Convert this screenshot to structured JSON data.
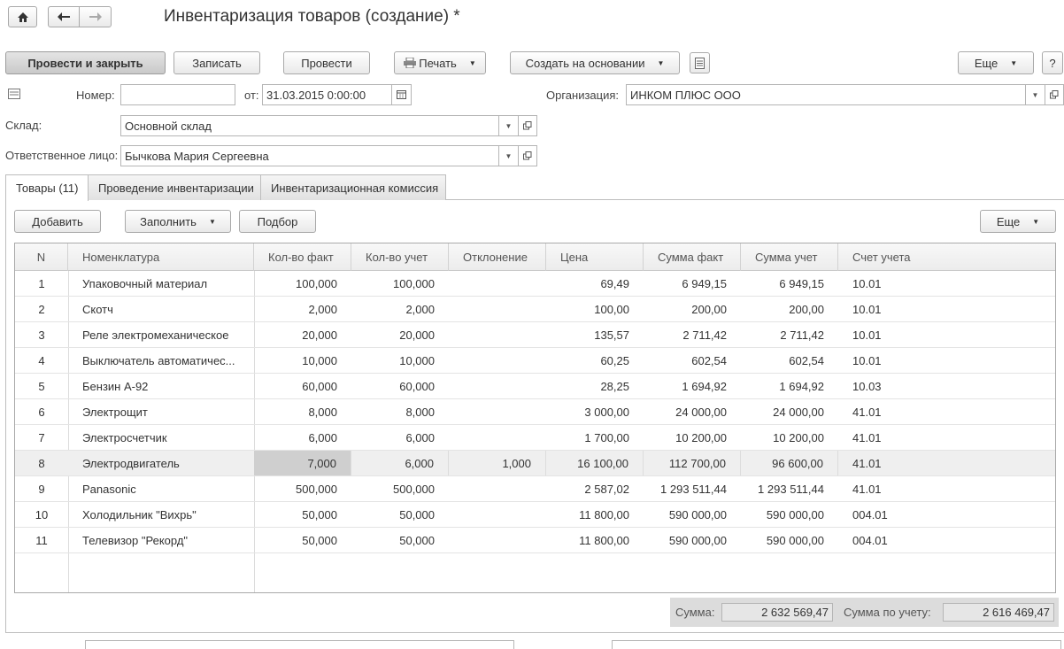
{
  "nav": {
    "home_icon": "home-icon",
    "back_icon": "arrow-left-icon",
    "forward_icon": "arrow-right-icon"
  },
  "title": "Инвентаризация товаров (создание) *",
  "toolbar": {
    "post_close": "Провести и закрыть",
    "save": "Записать",
    "post": "Провести",
    "print": "Печать",
    "create_based": "Создать на основании",
    "more": "Еще",
    "help": "?"
  },
  "form": {
    "number_label": "Номер:",
    "number_value": "",
    "date_label": "от:",
    "date_value": "31.03.2015  0:00:00",
    "org_label": "Организация:",
    "org_value": "ИНКОМ ПЛЮС ООО",
    "warehouse_label": "Склад:",
    "warehouse_value": "Основной склад",
    "responsible_label": "Ответственное лицо:",
    "responsible_value": "Бычкова Мария Сергеевна"
  },
  "tabs": [
    "Товары (11)",
    "Проведение инвентаризации",
    "Инвентаризационная комиссия"
  ],
  "table_toolbar": {
    "add": "Добавить",
    "fill": "Заполнить",
    "select": "Подбор",
    "more": "Еще"
  },
  "table": {
    "columns": [
      "N",
      "Номенклатура",
      "Кол-во факт",
      "Кол-во учет",
      "Отклонение",
      "Цена",
      "Сумма факт",
      "Сумма учет",
      "Счет учета"
    ],
    "rows": [
      [
        "1",
        "Упаковочный материал",
        "100,000",
        "100,000",
        "",
        "69,49",
        "6 949,15",
        "6 949,15",
        "10.01"
      ],
      [
        "2",
        "Скотч",
        "2,000",
        "2,000",
        "",
        "100,00",
        "200,00",
        "200,00",
        "10.01"
      ],
      [
        "3",
        "Реле электромеханическое",
        "20,000",
        "20,000",
        "",
        "135,57",
        "2 711,42",
        "2 711,42",
        "10.01"
      ],
      [
        "4",
        "Выключатель автоматичес...",
        "10,000",
        "10,000",
        "",
        "60,25",
        "602,54",
        "602,54",
        "10.01"
      ],
      [
        "5",
        "Бензин А-92",
        "60,000",
        "60,000",
        "",
        "28,25",
        "1 694,92",
        "1 694,92",
        "10.03"
      ],
      [
        "6",
        "Электрощит",
        "8,000",
        "8,000",
        "",
        "3 000,00",
        "24 000,00",
        "24 000,00",
        "41.01"
      ],
      [
        "7",
        "Электросчетчик",
        "6,000",
        "6,000",
        "",
        "1 700,00",
        "10 200,00",
        "10 200,00",
        "41.01"
      ],
      [
        "8",
        "Электродвигатель",
        "7,000",
        "6,000",
        "1,000",
        "16 100,00",
        "112 700,00",
        "96 600,00",
        "41.01"
      ],
      [
        "9",
        "Panasonic",
        "500,000",
        "500,000",
        "",
        "2 587,02",
        "1 293 511,44",
        "1 293 511,44",
        "41.01"
      ],
      [
        "10",
        "Холодильник \"Вихрь\"",
        "50,000",
        "50,000",
        "",
        "11 800,00",
        "590 000,00",
        "590 000,00",
        "004.01"
      ],
      [
        "11",
        "Телевизор \"Рекорд\"",
        "50,000",
        "50,000",
        "",
        "11 800,00",
        "590 000,00",
        "590 000,00",
        "004.01"
      ]
    ],
    "selected_row": 8
  },
  "totals": {
    "sum_label": "Сумма:",
    "sum_value": "2 632 569,47",
    "sum_acc_label": "Сумма по учету:",
    "sum_acc_value": "2 616 469,47"
  }
}
